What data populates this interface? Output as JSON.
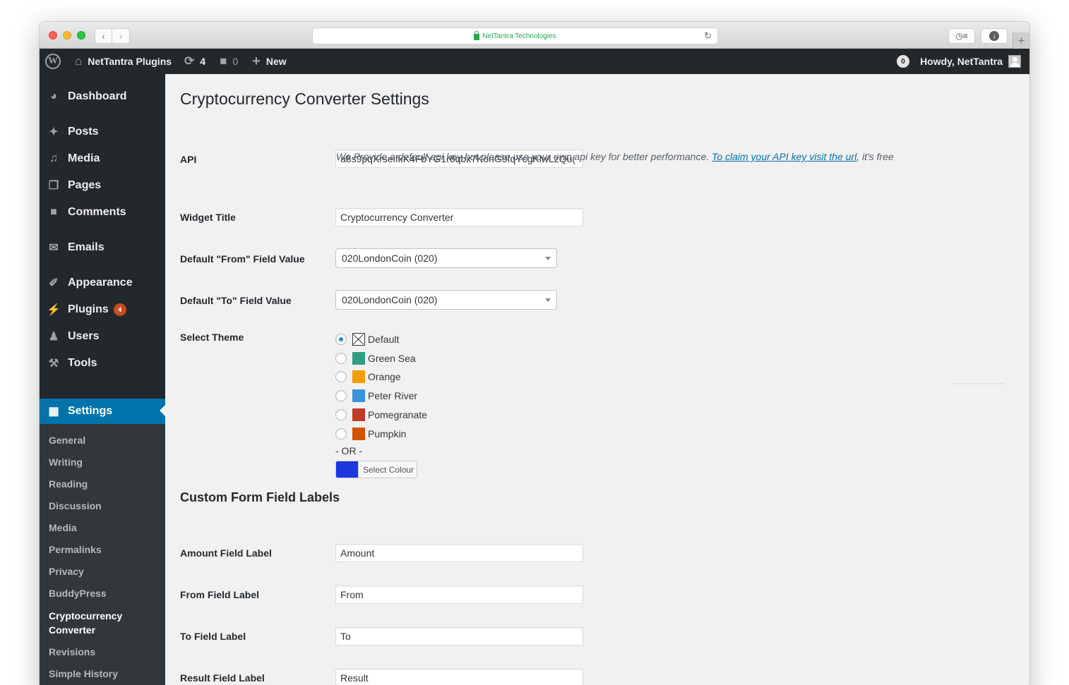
{
  "browser": {
    "url_display": "NetTantra Technologies",
    "secure": true
  },
  "admin_bar": {
    "site_name": "NetTantra Plugins",
    "updates_count": "4",
    "comments_count": "0",
    "new_label": "New",
    "notifications_count": "0",
    "greeting": "Howdy, NetTantra"
  },
  "sidebar": {
    "items": [
      {
        "label": "Dashboard",
        "icon": "dashboard-icon"
      },
      {
        "label": "Posts",
        "icon": "pin-icon"
      },
      {
        "label": "Media",
        "icon": "media-icon"
      },
      {
        "label": "Pages",
        "icon": "pages-icon"
      },
      {
        "label": "Comments",
        "icon": "comment-icon"
      },
      {
        "label": "Emails",
        "icon": "envelope-icon"
      },
      {
        "label": "Appearance",
        "icon": "brush-icon"
      },
      {
        "label": "Plugins",
        "icon": "plug-icon",
        "badge": "4"
      },
      {
        "label": "Users",
        "icon": "user-icon"
      },
      {
        "label": "Tools",
        "icon": "wrench-icon"
      },
      {
        "label": "Settings",
        "icon": "settings-icon",
        "active": true
      }
    ],
    "submenu": [
      {
        "label": "General"
      },
      {
        "label": "Writing"
      },
      {
        "label": "Reading"
      },
      {
        "label": "Discussion"
      },
      {
        "label": "Media"
      },
      {
        "label": "Permalinks"
      },
      {
        "label": "Privacy"
      },
      {
        "label": "BuddyPress"
      },
      {
        "label": "Cryptocurrency Converter",
        "current": true
      },
      {
        "label": "Revisions"
      },
      {
        "label": "Simple History"
      }
    ]
  },
  "page": {
    "title": "Cryptocurrency Converter Settings",
    "api": {
      "label": "API",
      "value": "a8s9pqXrseifkK4FbYG1r6qbx7KonG9fqYcgKlwLzQu(",
      "description": "We Provide a default api key but please use your own api key for better performance.",
      "link_text": "To claim your API key visit the url",
      "description_suffix": ", it's free"
    },
    "widget_title": {
      "label": "Widget Title",
      "value": "Cryptocurrency Converter"
    },
    "from_default": {
      "label": "Default \"From\" Field Value",
      "selected": "020LondonCoin (020)"
    },
    "to_default": {
      "label": "Default \"To\" Field Value",
      "selected": "020LondonCoin (020)"
    },
    "theme": {
      "label": "Select Theme",
      "options": [
        {
          "label": "Default",
          "color": null,
          "checked": true
        },
        {
          "label": "Green Sea",
          "color": "#2e9f82"
        },
        {
          "label": "Orange",
          "color": "#f19d00"
        },
        {
          "label": "Peter River",
          "color": "#3c93dc"
        },
        {
          "label": "Pomegranate",
          "color": "#bf3a27"
        },
        {
          "label": "Pumpkin",
          "color": "#d25400"
        }
      ],
      "or_text": "- OR -",
      "select_colour_label": "Select Colour",
      "custom_colour": "#1c36e0"
    },
    "custom_labels": {
      "title": "Custom Form Field Labels",
      "fields": [
        {
          "label": "Amount Field Label",
          "value": "Amount"
        },
        {
          "label": "From Field Label",
          "value": "From"
        },
        {
          "label": "To Field Label",
          "value": "To"
        },
        {
          "label": "Result Field Label",
          "value": "Result"
        }
      ]
    }
  }
}
